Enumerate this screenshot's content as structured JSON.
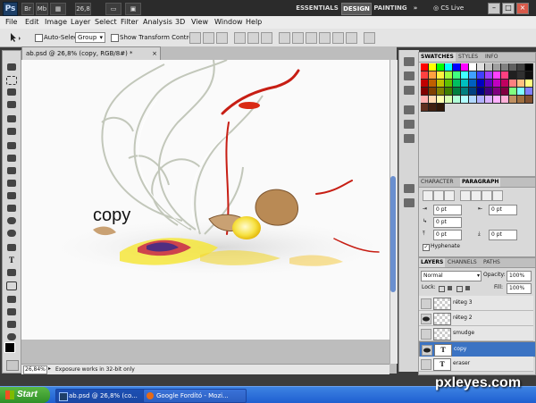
{
  "app": {
    "logo": "Ps",
    "zoom": "26,8",
    "workspaces": [
      "ESSENTIALS",
      "DESIGN",
      "PAINTING"
    ],
    "active_workspace": "DESIGN",
    "more": "»",
    "cs_live": "CS Live",
    "window_buttons": [
      "–",
      "□",
      "×"
    ]
  },
  "menu": [
    "File",
    "Edit",
    "Image",
    "Layer",
    "Select",
    "Filter",
    "Analysis",
    "3D",
    "View",
    "Window",
    "Help"
  ],
  "options": {
    "auto_select_label": "Auto-Select:",
    "auto_select_value": "Group",
    "show_transform_label": "Show Transform Controls"
  },
  "document": {
    "tab_title": "ab.psd @ 26,8% (copy, RGB/8#) *",
    "tab_close": "×",
    "canvas_text": "copy",
    "zoom_field": "26,84%",
    "status_message": "Exposure works in 32-bit only"
  },
  "swatches_panel": {
    "tabs": [
      "SWATCHES",
      "STYLES",
      "INFO"
    ],
    "active": "SWATCHES",
    "colors": [
      "#ff0000",
      "#ffff00",
      "#00ff00",
      "#00ffff",
      "#0000ff",
      "#ff00ff",
      "#ffffff",
      "#e0e0e0",
      "#c0c0c0",
      "#a0a0a0",
      "#808080",
      "#606060",
      "#404040",
      "#000000",
      "#ff4040",
      "#ffa040",
      "#fff040",
      "#a0ff40",
      "#40ff80",
      "#40ffff",
      "#40a0ff",
      "#4040ff",
      "#a040ff",
      "#ff40ff",
      "#ff4080",
      "#202020",
      "#303030",
      "#101010",
      "#c00000",
      "#c06000",
      "#c0c000",
      "#60c000",
      "#00c060",
      "#00c0c0",
      "#0060c0",
      "#0000c0",
      "#6000c0",
      "#c000c0",
      "#c00060",
      "#ff8080",
      "#ffc080",
      "#ffff80",
      "#800000",
      "#804000",
      "#808000",
      "#408000",
      "#008040",
      "#008080",
      "#004080",
      "#000080",
      "#400080",
      "#800080",
      "#800040",
      "#80ff80",
      "#80ffff",
      "#8080ff",
      "#ffb0b0",
      "#ffd8b0",
      "#ffffb0",
      "#d8ffb0",
      "#b0ffd8",
      "#b0ffff",
      "#b0d8ff",
      "#b0b0ff",
      "#d8b0ff",
      "#ffb0ff",
      "#ffb0d8",
      "#c09060",
      "#a07040",
      "#805030",
      "#603020",
      "#402010",
      "#301808"
    ]
  },
  "paragraph_panel": {
    "tabs": [
      "CHARACTER",
      "PARAGRAPH"
    ],
    "active": "PARAGRAPH",
    "indent_left": "0 pt",
    "indent_right": "0 pt",
    "first_line": "0 pt",
    "space_before": "0 pt",
    "space_after": "0 pt",
    "hyphenate_label": "Hyphenate",
    "hyphenate_checked": true
  },
  "layers_panel": {
    "tabs": [
      "LAYERS",
      "CHANNELS",
      "PATHS"
    ],
    "active": "LAYERS",
    "blend_mode": "Normal",
    "opacity_label": "Opacity:",
    "opacity_value": "100%",
    "lock_label": "Lock:",
    "fill_label": "Fill:",
    "fill_value": "100%",
    "layers": [
      {
        "name": "réteg 3",
        "type": "pixel",
        "visible": false,
        "selected": false
      },
      {
        "name": "réteg 2",
        "type": "pixel",
        "visible": true,
        "selected": false
      },
      {
        "name": "smudge",
        "type": "pixel",
        "visible": false,
        "selected": false
      },
      {
        "name": "copy",
        "type": "text",
        "visible": true,
        "selected": true
      },
      {
        "name": "eraser",
        "type": "text",
        "visible": false,
        "selected": false
      }
    ]
  },
  "taskbar": {
    "start": "Start",
    "tasks": [
      "ab.psd @ 26,8% (co...",
      "Google Fordító - Mozi..."
    ]
  },
  "watermark": "pxleyes.com"
}
